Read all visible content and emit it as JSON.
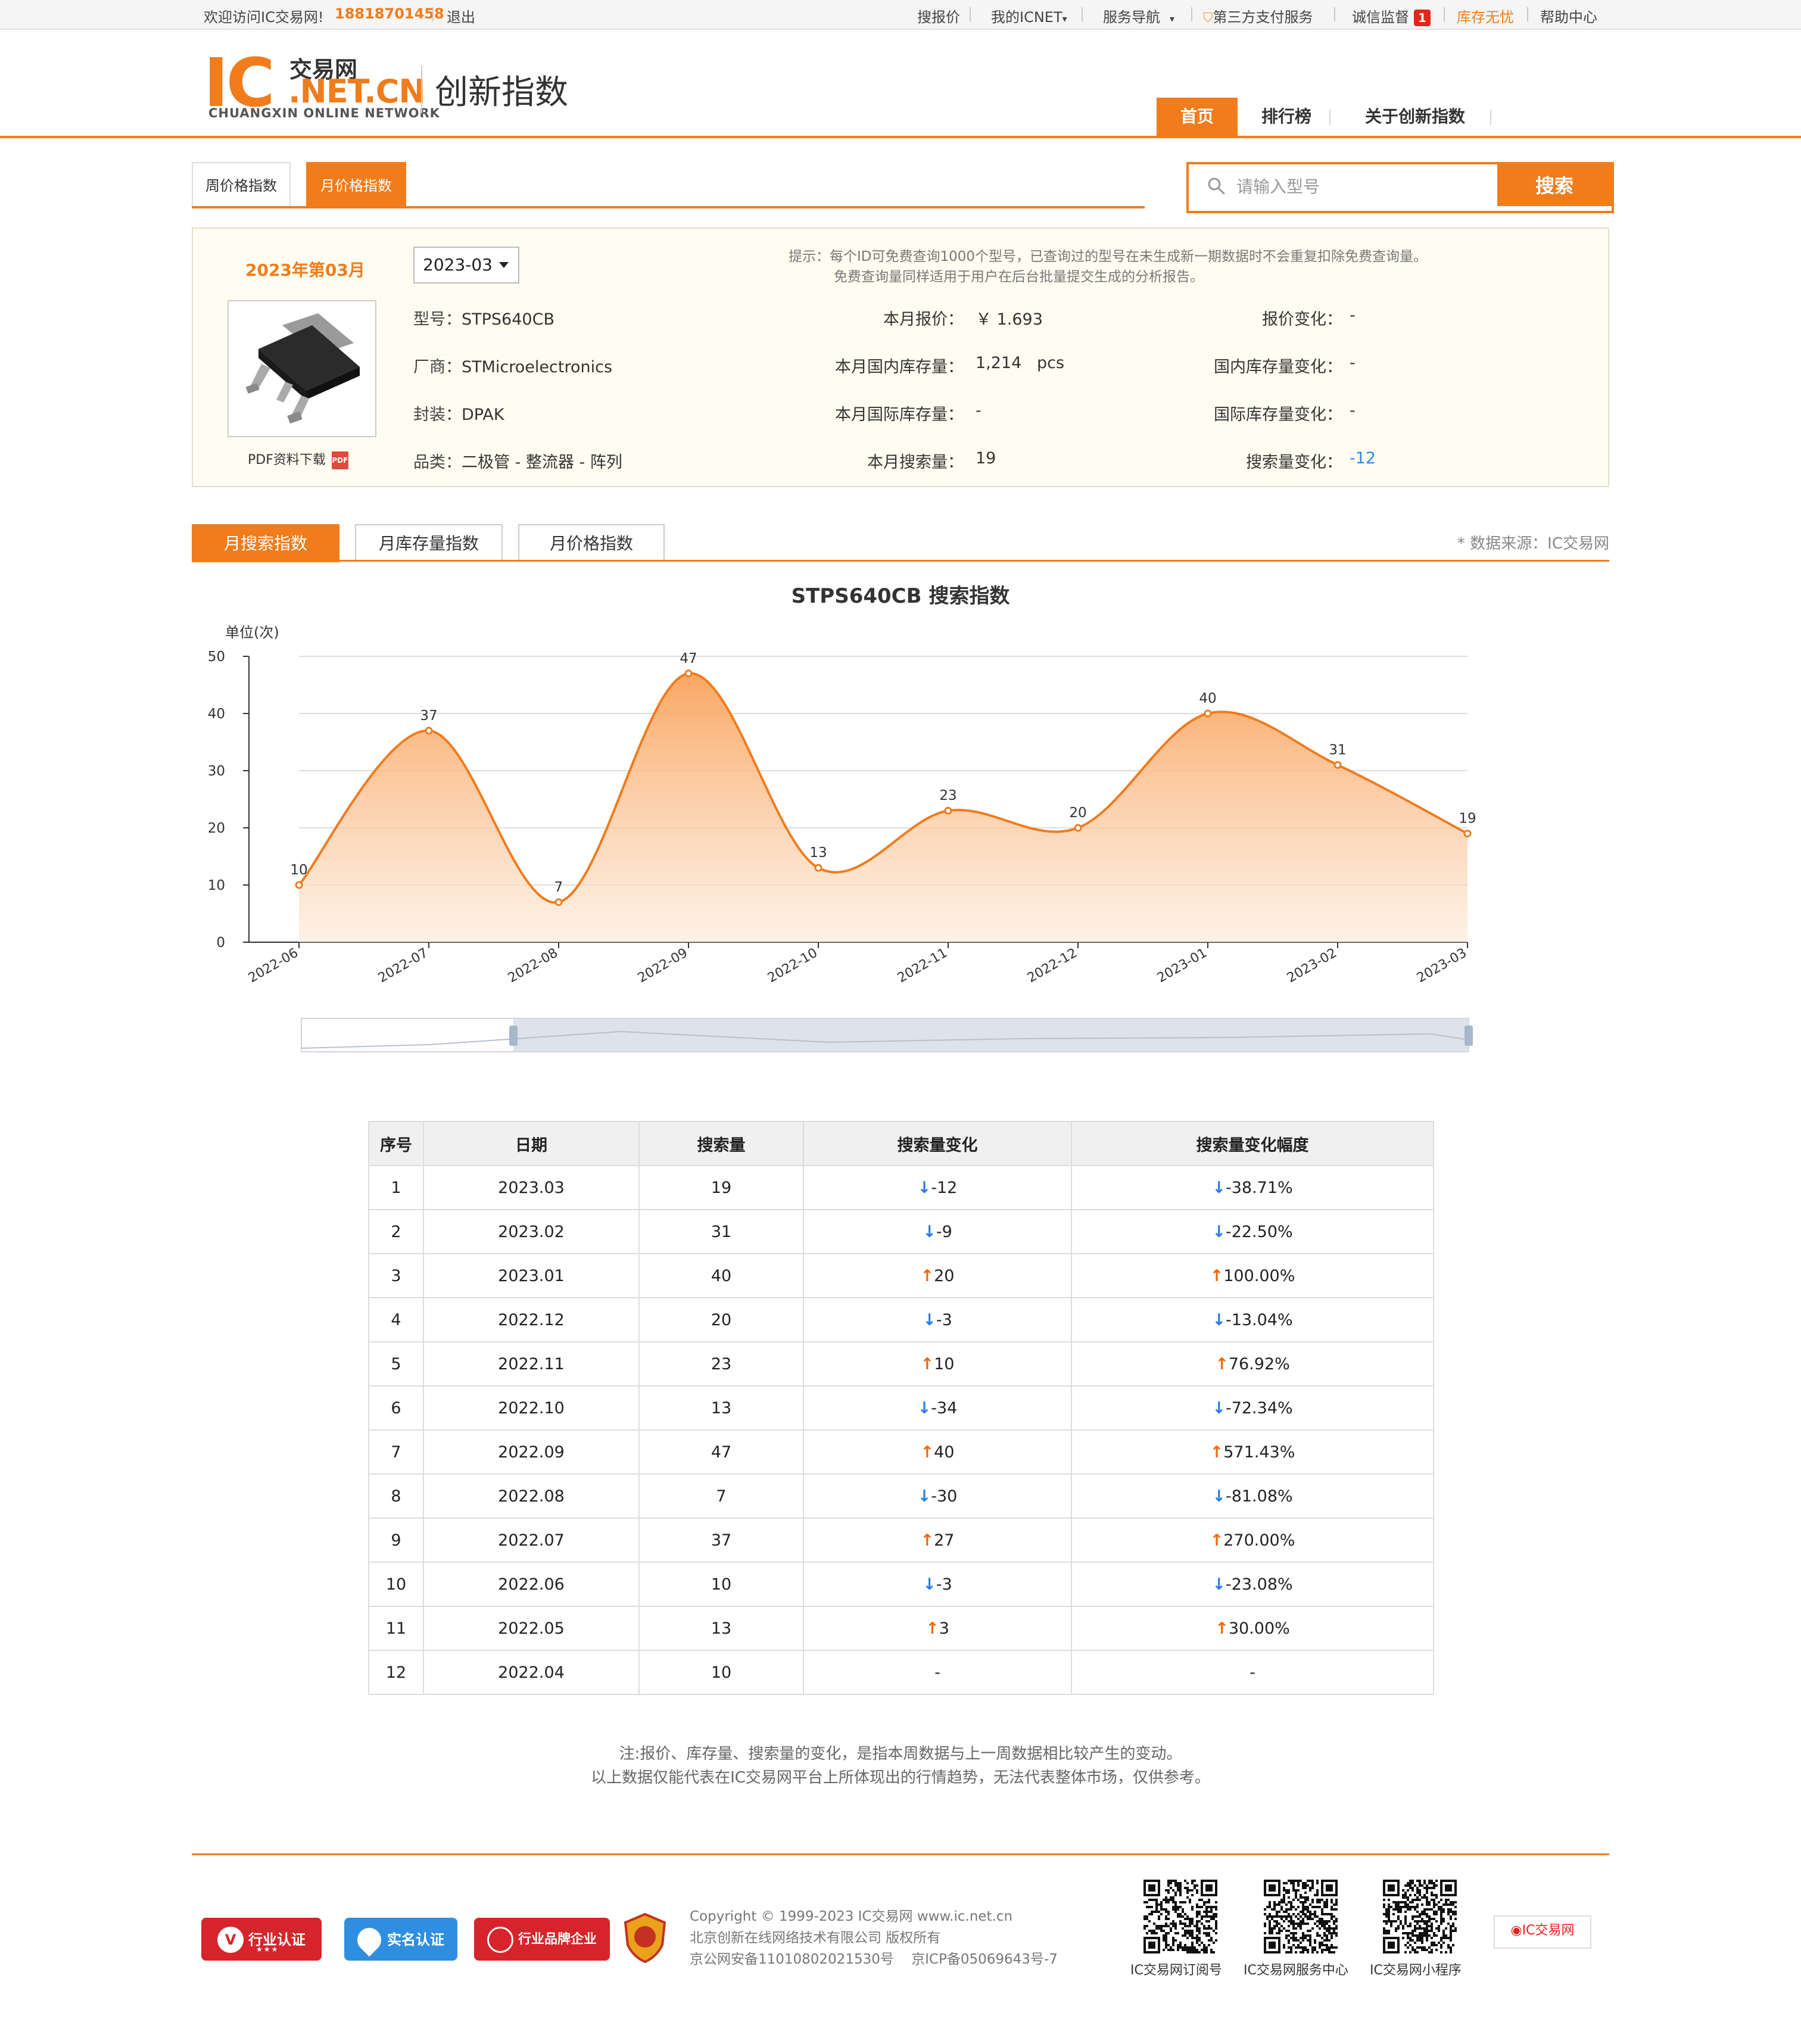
{
  "topbar": {
    "welcome": "欢迎访问IC交易网!",
    "phone": "18818701458",
    "logout": "退出",
    "links": [
      "搜报价",
      "我的ICNET",
      "服务导航",
      "第三方支付服务",
      "诚信监督",
      "库存无忧",
      "帮助中心"
    ],
    "badge": "1"
  },
  "header": {
    "logo_ic": "IC",
    "logo_cn_top": "交易网",
    "logo_netcn": ".NET.CN",
    "logo_sub": "CHUANGXIN ONLINE NETWORK",
    "title": "创新指数",
    "nav": [
      "首页",
      "排行榜",
      "关于创新指数"
    ]
  },
  "type_tabs": [
    "周价格指数",
    "月价格指数"
  ],
  "search": {
    "placeholder": "请输入型号",
    "button": "搜索"
  },
  "info": {
    "month_title": "2023年第03月",
    "month_select": "2023-03",
    "tip_line1": "提示：每个ID可免费查询1000个型号，已查询过的型号在未生成新一期数据时不会重复扣除免费查询量。",
    "tip_line2": "免费查询量同样适用于用户在后台批量提交生成的分析报告。",
    "pdf": "PDF资料下载",
    "pdf_icon": "PDF",
    "fields": {
      "model_label": "型号：",
      "model": "STPS640CB",
      "maker_label": "厂商：",
      "maker": "STMicroelectronics",
      "package_label": "封装：",
      "package": "DPAK",
      "category_label": "品类：",
      "category": "二极管 - 整流器 - 阵列",
      "price_label": "本月报价：",
      "price": "￥ 1.693",
      "dom_stock_label": "本月国内库存量：",
      "dom_stock": "1,214   pcs",
      "intl_stock_label": "本月国际库存量：",
      "intl_stock": "-",
      "search_label": "本月搜索量：",
      "search": "19",
      "price_chg_label": "报价变化：",
      "price_chg": "-",
      "dom_chg_label": "国内库存量变化：",
      "dom_chg": "-",
      "intl_chg_label": "国际库存量变化：",
      "intl_chg": "-",
      "search_chg_label": "搜索量变化：",
      "search_chg": "-12"
    }
  },
  "index_tabs": [
    "月搜索指数",
    "月库存量指数",
    "月价格指数"
  ],
  "source": "* 数据来源：IC交易网",
  "chart_data": {
    "type": "area",
    "title": "STPS640CB 搜索指数",
    "ylabel": "单位(次)",
    "xlabel": "",
    "categories": [
      "2022-06",
      "2022-07",
      "2022-08",
      "2022-09",
      "2022-10",
      "2022-11",
      "2022-12",
      "2023-01",
      "2023-02",
      "2023-03"
    ],
    "values": [
      10,
      37,
      7,
      47,
      13,
      23,
      20,
      40,
      31,
      19
    ],
    "ylim": [
      0,
      50
    ],
    "yticks": [
      0,
      10,
      20,
      30,
      40,
      50
    ],
    "grid": true,
    "color": "#f07c1c"
  },
  "table": {
    "headers": [
      "序号",
      "日期",
      "搜索量",
      "搜索量变化",
      "搜索量变化幅度"
    ],
    "rows": [
      {
        "no": "1",
        "date": "2023.03",
        "count": "19",
        "dir": "down",
        "chg": "-12",
        "pct": "-38.71%"
      },
      {
        "no": "2",
        "date": "2023.02",
        "count": "31",
        "dir": "down",
        "chg": "-9",
        "pct": "-22.50%"
      },
      {
        "no": "3",
        "date": "2023.01",
        "count": "40",
        "dir": "up",
        "chg": "20",
        "pct": "100.00%"
      },
      {
        "no": "4",
        "date": "2022.12",
        "count": "20",
        "dir": "down",
        "chg": "-3",
        "pct": "-13.04%"
      },
      {
        "no": "5",
        "date": "2022.11",
        "count": "23",
        "dir": "up",
        "chg": "10",
        "pct": "76.92%"
      },
      {
        "no": "6",
        "date": "2022.10",
        "count": "13",
        "dir": "down",
        "chg": "-34",
        "pct": "-72.34%"
      },
      {
        "no": "7",
        "date": "2022.09",
        "count": "47",
        "dir": "up",
        "chg": "40",
        "pct": "571.43%"
      },
      {
        "no": "8",
        "date": "2022.08",
        "count": "7",
        "dir": "down",
        "chg": "-30",
        "pct": "-81.08%"
      },
      {
        "no": "9",
        "date": "2022.07",
        "count": "37",
        "dir": "up",
        "chg": "27",
        "pct": "270.00%"
      },
      {
        "no": "10",
        "date": "2022.06",
        "count": "10",
        "dir": "down",
        "chg": "-3",
        "pct": "-23.08%"
      },
      {
        "no": "11",
        "date": "2022.05",
        "count": "13",
        "dir": "up",
        "chg": "3",
        "pct": "30.00%"
      },
      {
        "no": "12",
        "date": "2022.04",
        "count": "10",
        "dir": "none",
        "chg": "-",
        "pct": "-"
      }
    ]
  },
  "notes": {
    "line1": "注:报价、库存量、搜索量的变化，是指本周数据与上一周数据相比较产生的变动。",
    "line2": "以上数据仅能代表在IC交易网平台上所体现出的行情趋势，无法代表整体市场，仅供参考。"
  },
  "footer": {
    "certs": [
      "行业认证",
      "实名认证",
      "行业品牌企业"
    ],
    "cert_stars": "★★★",
    "copyright": "Copyright © 1999-2023 IC交易网 www.ic.net.cn",
    "company": "北京创新在线网络技术有限公司 版权所有",
    "icp": "京公网安备11010802021530号    京ICP备05069643号-7",
    "qr_labels": [
      "IC交易网订阅号",
      "IC交易网服务中心",
      "IC交易网小程序"
    ],
    "weibo": "IC交易网"
  }
}
